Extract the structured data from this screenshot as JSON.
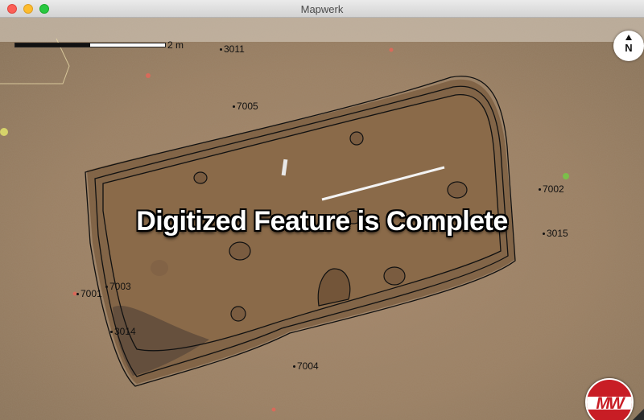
{
  "window": {
    "title": "Mapwerk"
  },
  "scale": {
    "label": "2 m"
  },
  "north": {
    "label": "N"
  },
  "banner": {
    "text": "Digitized Feature is Complete"
  },
  "logo": {
    "text": "MW",
    "color": "#c81d25"
  },
  "features": [
    {
      "id": "3011"
    },
    {
      "id": "7005"
    },
    {
      "id": "7002"
    },
    {
      "id": "3015"
    },
    {
      "id": "7001"
    },
    {
      "id": "7003"
    },
    {
      "id": "3014"
    },
    {
      "id": "7004"
    }
  ]
}
